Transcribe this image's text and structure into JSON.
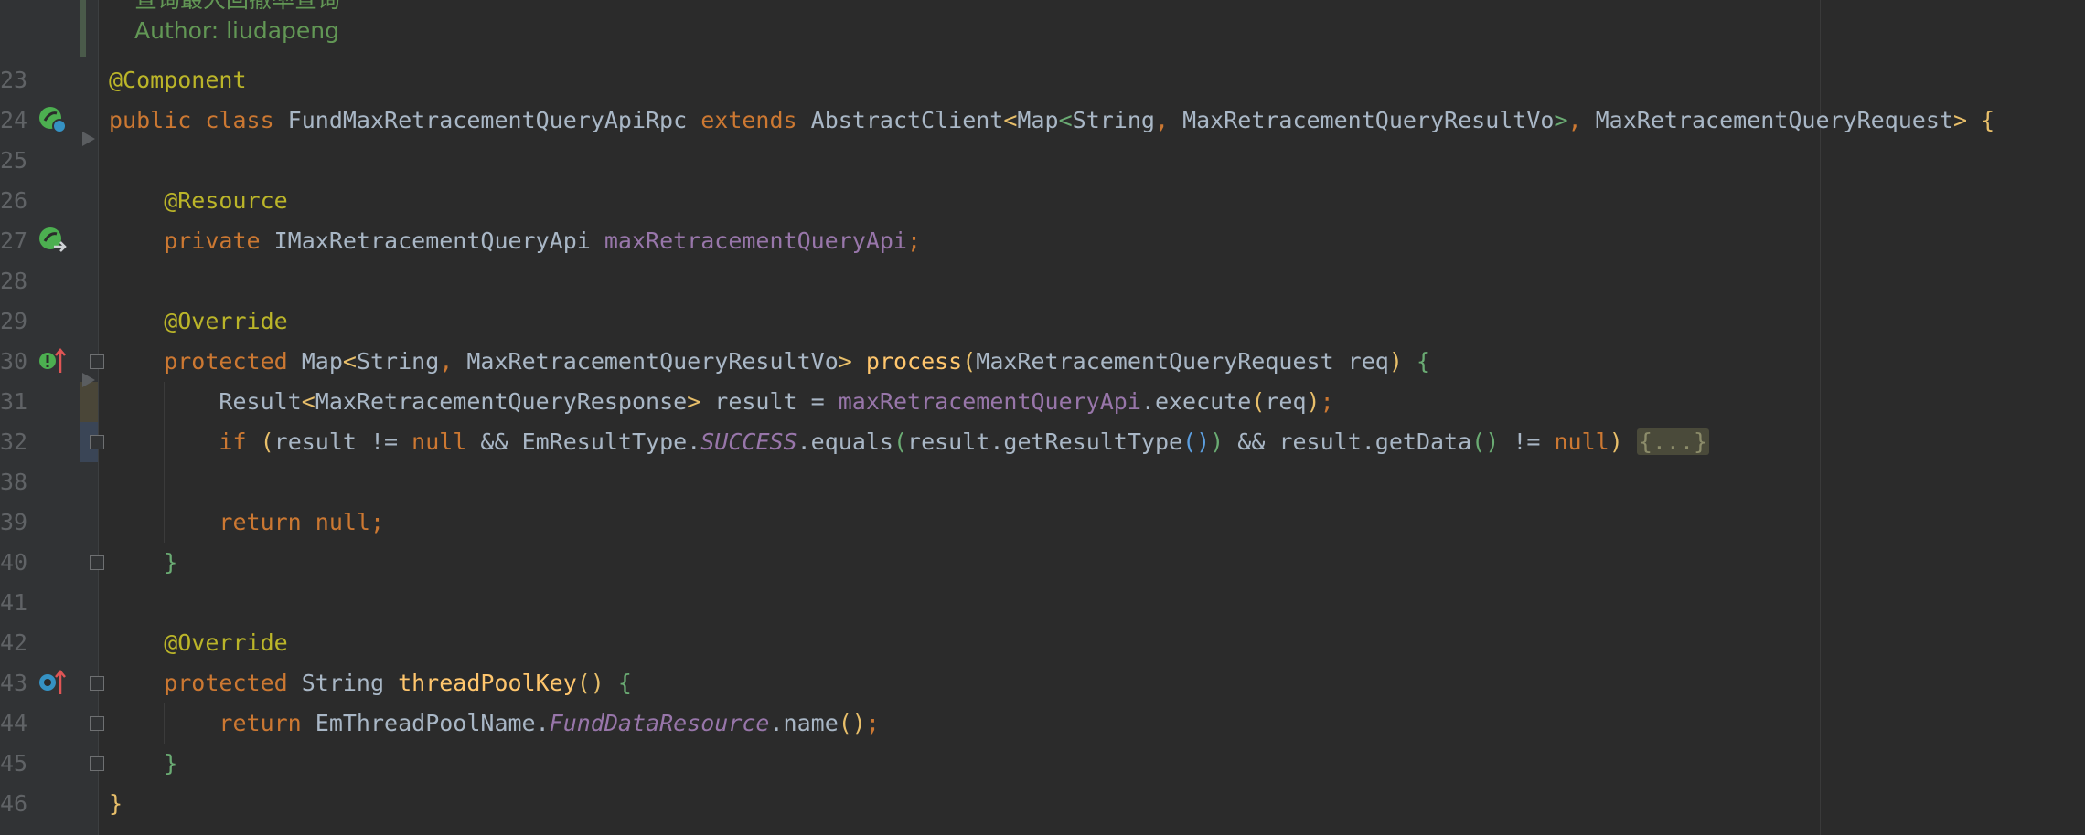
{
  "doc_comment": {
    "clipped_text": "查询最大回撤率查询",
    "author": "Author: liudapeng"
  },
  "lines": [
    {
      "num": "23",
      "segments": [
        {
          "t": "@Component",
          "c": "ann"
        }
      ]
    },
    {
      "num": "24",
      "segments": [
        {
          "t": "public class ",
          "c": "kw"
        },
        {
          "t": "FundMaxRetracementQueryApiRpc ",
          "c": ""
        },
        {
          "t": "extends ",
          "c": "kw"
        },
        {
          "t": "AbstractClient",
          "c": ""
        },
        {
          "t": "<",
          "c": "br-y"
        },
        {
          "t": "Map",
          "c": ""
        },
        {
          "t": "<",
          "c": "br-g"
        },
        {
          "t": "String",
          "c": ""
        },
        {
          "t": ", ",
          "c": "kw"
        },
        {
          "t": "MaxRetracementQueryResultVo",
          "c": ""
        },
        {
          "t": ">",
          "c": "br-g"
        },
        {
          "t": ", ",
          "c": "kw"
        },
        {
          "t": "MaxRetracementQueryRequest",
          "c": ""
        },
        {
          "t": "> {",
          "c": "br-y"
        }
      ]
    },
    {
      "num": "25",
      "segments": []
    },
    {
      "num": "26",
      "segments": [
        {
          "t": "    @Resource",
          "c": "ann"
        }
      ]
    },
    {
      "num": "27",
      "segments": [
        {
          "t": "    private ",
          "c": "kw"
        },
        {
          "t": "IMaxRetracementQueryApi ",
          "c": ""
        },
        {
          "t": "maxRetracementQueryApi",
          "c": "fld"
        },
        {
          "t": ";",
          "c": "kw"
        }
      ]
    },
    {
      "num": "28",
      "segments": []
    },
    {
      "num": "29",
      "segments": [
        {
          "t": "    @Override",
          "c": "ann"
        }
      ]
    },
    {
      "num": "30",
      "segments": [
        {
          "t": "    protected ",
          "c": "kw"
        },
        {
          "t": "Map",
          "c": ""
        },
        {
          "t": "<",
          "c": "br-y"
        },
        {
          "t": "String",
          "c": ""
        },
        {
          "t": ", ",
          "c": "kw"
        },
        {
          "t": "MaxRetracementQueryResultVo",
          "c": ""
        },
        {
          "t": "> ",
          "c": "br-y"
        },
        {
          "t": "process",
          "c": "mth"
        },
        {
          "t": "(",
          "c": "br-y"
        },
        {
          "t": "MaxRetracementQueryRequest req",
          "c": ""
        },
        {
          "t": ") ",
          "c": "br-y"
        },
        {
          "t": "{",
          "c": "br-g"
        }
      ]
    },
    {
      "num": "31",
      "segments": [
        {
          "t": "        Result",
          "c": ""
        },
        {
          "t": "<",
          "c": "br-y"
        },
        {
          "t": "MaxRetracementQueryResponse",
          "c": ""
        },
        {
          "t": "> ",
          "c": "br-y"
        },
        {
          "t": "result = ",
          "c": ""
        },
        {
          "t": "maxRetracementQueryApi",
          "c": "fld"
        },
        {
          "t": ".execute",
          "c": ""
        },
        {
          "t": "(",
          "c": "br-y"
        },
        {
          "t": "req",
          "c": ""
        },
        {
          "t": ")",
          "c": "br-y"
        },
        {
          "t": ";",
          "c": "kw"
        }
      ]
    },
    {
      "num": "32",
      "segments": [
        {
          "t": "        if ",
          "c": "kw"
        },
        {
          "t": "(",
          "c": "br-y"
        },
        {
          "t": "result != ",
          "c": ""
        },
        {
          "t": "null ",
          "c": "kw"
        },
        {
          "t": "&& EmResultType.",
          "c": ""
        },
        {
          "t": "SUCCESS",
          "c": "ital"
        },
        {
          "t": ".equals",
          "c": ""
        },
        {
          "t": "(",
          "c": "br-g"
        },
        {
          "t": "result.getResultType",
          "c": ""
        },
        {
          "t": "()",
          "c": "br-b"
        },
        {
          "t": ")",
          "c": "br-g"
        },
        {
          "t": " && result.getData",
          "c": ""
        },
        {
          "t": "()",
          "c": "br-g"
        },
        {
          "t": " != ",
          "c": ""
        },
        {
          "t": "null",
          "c": "kw"
        },
        {
          "t": ") ",
          "c": "br-y"
        },
        {
          "t": "{...}",
          "c": "folded"
        }
      ]
    },
    {
      "num": "38",
      "segments": []
    },
    {
      "num": "39",
      "segments": [
        {
          "t": "        return null",
          "c": "kw"
        },
        {
          "t": ";",
          "c": "kw"
        }
      ]
    },
    {
      "num": "40",
      "segments": [
        {
          "t": "    }",
          "c": "br-g"
        }
      ]
    },
    {
      "num": "41",
      "segments": []
    },
    {
      "num": "42",
      "segments": [
        {
          "t": "    @Override",
          "c": "ann"
        }
      ]
    },
    {
      "num": "43",
      "segments": [
        {
          "t": "    protected ",
          "c": "kw"
        },
        {
          "t": "String ",
          "c": ""
        },
        {
          "t": "threadPoolKey",
          "c": "mth"
        },
        {
          "t": "() ",
          "c": "br-y"
        },
        {
          "t": "{",
          "c": "br-g"
        }
      ]
    },
    {
      "num": "44",
      "segments": [
        {
          "t": "        return ",
          "c": "kw"
        },
        {
          "t": "EmThreadPoolName.",
          "c": ""
        },
        {
          "t": "FundDataResource",
          "c": "ital"
        },
        {
          "t": ".name",
          "c": ""
        },
        {
          "t": "()",
          "c": "br-y"
        },
        {
          "t": ";",
          "c": "kw"
        }
      ]
    },
    {
      "num": "45",
      "segments": [
        {
          "t": "    }",
          "c": "br-g"
        }
      ]
    },
    {
      "num": "46",
      "segments": [
        {
          "t": "}",
          "c": "br-y"
        }
      ]
    }
  ],
  "gutter_icons": [
    {
      "line": "24",
      "name": "spring-bean-icon",
      "color": "#4caf50"
    },
    {
      "line": "27",
      "name": "spring-autowire-icon",
      "color": "#4caf50"
    },
    {
      "line": "30",
      "name": "implements-method-icon",
      "color": "#4caf50"
    },
    {
      "line": "43",
      "name": "overrides-method-icon",
      "color": "#3592c4"
    }
  ]
}
